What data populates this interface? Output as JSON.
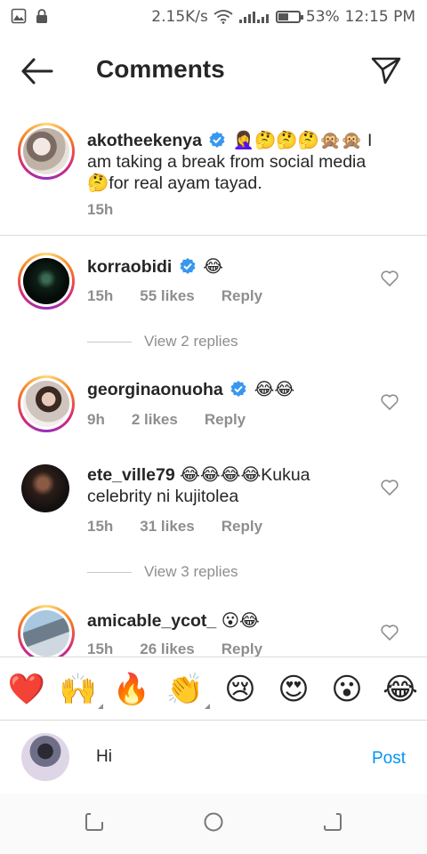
{
  "status_bar": {
    "speed": "2.15K/s",
    "battery": "53%",
    "battery_level": 0.53,
    "time": "12:15 PM"
  },
  "header": {
    "title": "Comments"
  },
  "comments": [
    {
      "username": "akotheekenya",
      "verified": true,
      "emojis": "🤦‍♀️🤔🤔🤔🙊🙊",
      "text": "I am taking a break from social media 🤔for real ayam tayad.",
      "time": "15h",
      "likes": "",
      "reply": ""
    },
    {
      "username": "korraobidi",
      "verified": true,
      "emojis": "😂",
      "text": "",
      "time": "15h",
      "likes": "55 likes",
      "reply": "Reply"
    },
    {
      "username": "georginaonuoha",
      "verified": true,
      "emojis": "😂😂",
      "text": "",
      "time": "9h",
      "likes": "2 likes",
      "reply": "Reply"
    },
    {
      "username": "ete_ville79",
      "verified": false,
      "emojis": "😂😂😂😂",
      "text": "Kukua celebrity ni kujitolea",
      "time": "15h",
      "likes": "31 likes",
      "reply": "Reply"
    },
    {
      "username": "amicable_ycot_",
      "verified": false,
      "emojis": "😮😂",
      "text": "",
      "time": "15h",
      "likes": "26 likes",
      "reply": "Reply"
    }
  ],
  "replies": {
    "first": "View 2 replies",
    "second": "View 3 replies"
  },
  "emoji_bar": [
    "❤️",
    "🙌",
    "🔥",
    "👏",
    "😢",
    "😍",
    "😮",
    "😂"
  ],
  "composer": {
    "value": "Hi",
    "post_label": "Post"
  },
  "colors": {
    "text": "#262626",
    "muted": "#8e8e8e",
    "link": "#0095f6",
    "verified": "#3897f0"
  },
  "icons": [
    "gallery-icon",
    "lock-icon",
    "wifi-icon",
    "signal-icon",
    "battery-icon",
    "back-arrow-icon",
    "send-icon",
    "verified-badge-icon",
    "heart-outline-icon",
    "recents-icon",
    "home-icon",
    "back-nav-icon"
  ]
}
